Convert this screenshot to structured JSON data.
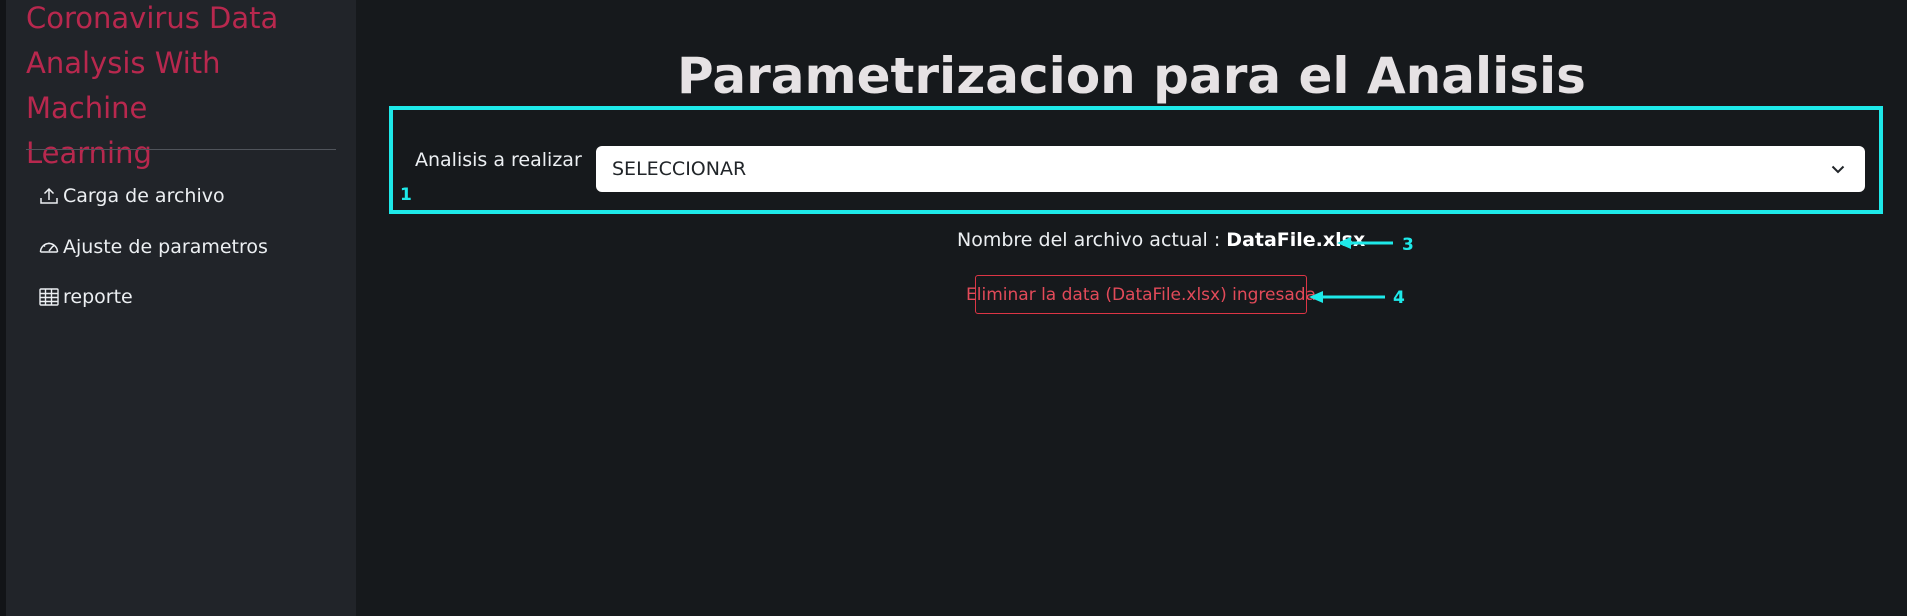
{
  "sidebar": {
    "brand_lines": [
      "Coronavirus Data",
      "Analysis With Machine",
      "Learning"
    ],
    "items": [
      {
        "label": "Carga de archivo",
        "icon": "upload-icon"
      },
      {
        "label": "Ajuste de parametros",
        "icon": "speedometer-icon"
      },
      {
        "label": "reporte",
        "icon": "table-icon"
      }
    ]
  },
  "main": {
    "title": "Parametrizacion para el Analisis",
    "analysis_label": "Analisis a realizar",
    "analysis_select_value": "SELECCIONAR",
    "file_prefix": "Nombre del archivo actual : ",
    "file_name": "DataFile.xlsx",
    "delete_button_label": "Eliminar la data (DataFile.xlsx) ingresada"
  },
  "annotations": {
    "n1": "1",
    "n3": "3",
    "n4": "4"
  },
  "colors": {
    "background": "#16191c",
    "sidebar": "#212429",
    "brand": "#b8284e",
    "annotation": "#1ee9e9",
    "danger": "#dc3545"
  }
}
